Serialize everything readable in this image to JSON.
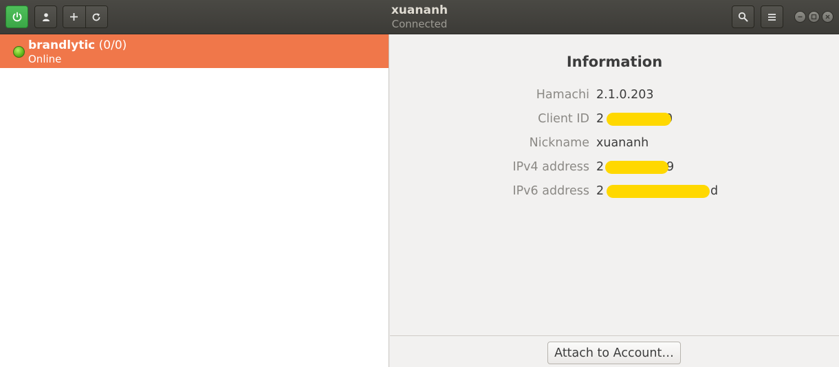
{
  "window": {
    "title": "xuananh",
    "subtitle": "Connected"
  },
  "toolbar": {
    "icons": [
      "power-icon",
      "contact-icon",
      "add-icon",
      "refresh-icon",
      "search-icon",
      "hamburger-menu-icon"
    ],
    "accent_power": "#3aa646"
  },
  "networks": [
    {
      "name": "brandlytic",
      "count": "(0/0)",
      "status": "Online",
      "row_color": "#f0774a"
    }
  ],
  "info": {
    "title": "Information",
    "rows": [
      {
        "label": "Hamachi",
        "value": "2.1.0.203"
      },
      {
        "label": "Client ID",
        "value_start": "2",
        "value_end": "0"
      },
      {
        "label": "Nickname",
        "value": "xuananh"
      },
      {
        "label": "IPv4 address",
        "value_start": "2",
        "value_end": "9"
      },
      {
        "label": "IPv6 address",
        "value_start": "2",
        "value_end": "d"
      }
    ]
  },
  "footer": {
    "attach_label": "Attach to Account…"
  },
  "colors": {
    "redaction": "#ffd800"
  }
}
